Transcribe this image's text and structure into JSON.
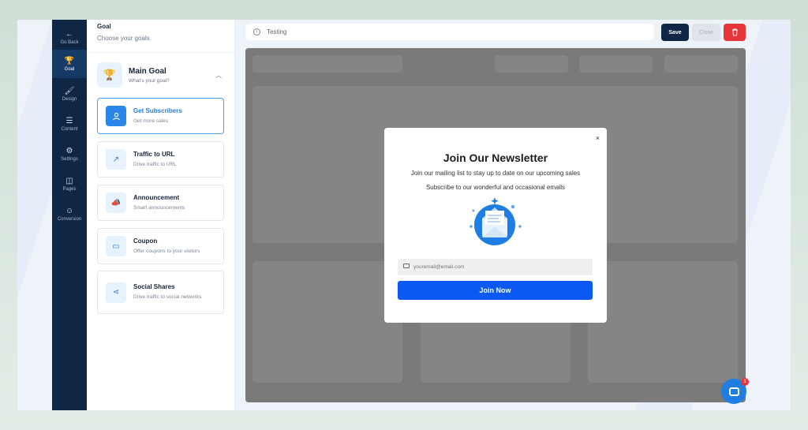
{
  "rail": {
    "items": [
      {
        "icon": "arrow-left-icon",
        "glyph": "←",
        "label": "Go Back"
      },
      {
        "icon": "trophy-icon",
        "glyph": "🏆",
        "label": "Goal"
      },
      {
        "icon": "brush-icon",
        "glyph": "🖌",
        "label": "Design"
      },
      {
        "icon": "content-icon",
        "glyph": "☰",
        "label": "Content"
      },
      {
        "icon": "sliders-icon",
        "glyph": "⚙",
        "label": "Settings"
      },
      {
        "icon": "pages-icon",
        "glyph": "◫",
        "label": "Pages"
      },
      {
        "icon": "people-icon",
        "glyph": "☺",
        "label": "Conversion"
      }
    ]
  },
  "panel": {
    "title": "Goal",
    "subtitle": "Choose your goals",
    "main_goal": {
      "title": "Main Goal",
      "subtitle": "What's your goal?",
      "icon": "trophy-icon"
    },
    "goals": [
      {
        "title": "Get Subscribers",
        "subtitle": "Get more sales",
        "icon": "user-icon",
        "glyph": "👤"
      },
      {
        "title": "Traffic to URL",
        "subtitle": "Drive traffic to URL",
        "icon": "trend-up-icon",
        "glyph": "↗"
      },
      {
        "title": "Announcement",
        "subtitle": "Smart announcements",
        "icon": "megaphone-icon",
        "glyph": "📣"
      },
      {
        "title": "Coupon",
        "subtitle": "Offer coupons to your visitors",
        "icon": "ticket-icon",
        "glyph": "▭"
      },
      {
        "title": "Social Shares",
        "subtitle": "Drive traffic to social networks",
        "icon": "share-icon",
        "glyph": "⋖"
      }
    ]
  },
  "topbar": {
    "page_name": "Testing",
    "save_label": "Save",
    "close_label": "Close",
    "delete_icon": "trash-icon"
  },
  "modal": {
    "close_glyph": "×",
    "title": "Join Our Newsletter",
    "line1": "Join our mailing list to stay up to date on our upcoming sales",
    "line2": "Subscribe to our wonderful and occasional emails",
    "email_placeholder": "youremail@email.com",
    "button_label": "Join Now"
  },
  "chat": {
    "badge_count": "1"
  },
  "colors": {
    "rail_bg": "#0f2744",
    "accent": "#2b86e8",
    "join_button": "#0b59f0",
    "delete_button": "#e53538"
  }
}
